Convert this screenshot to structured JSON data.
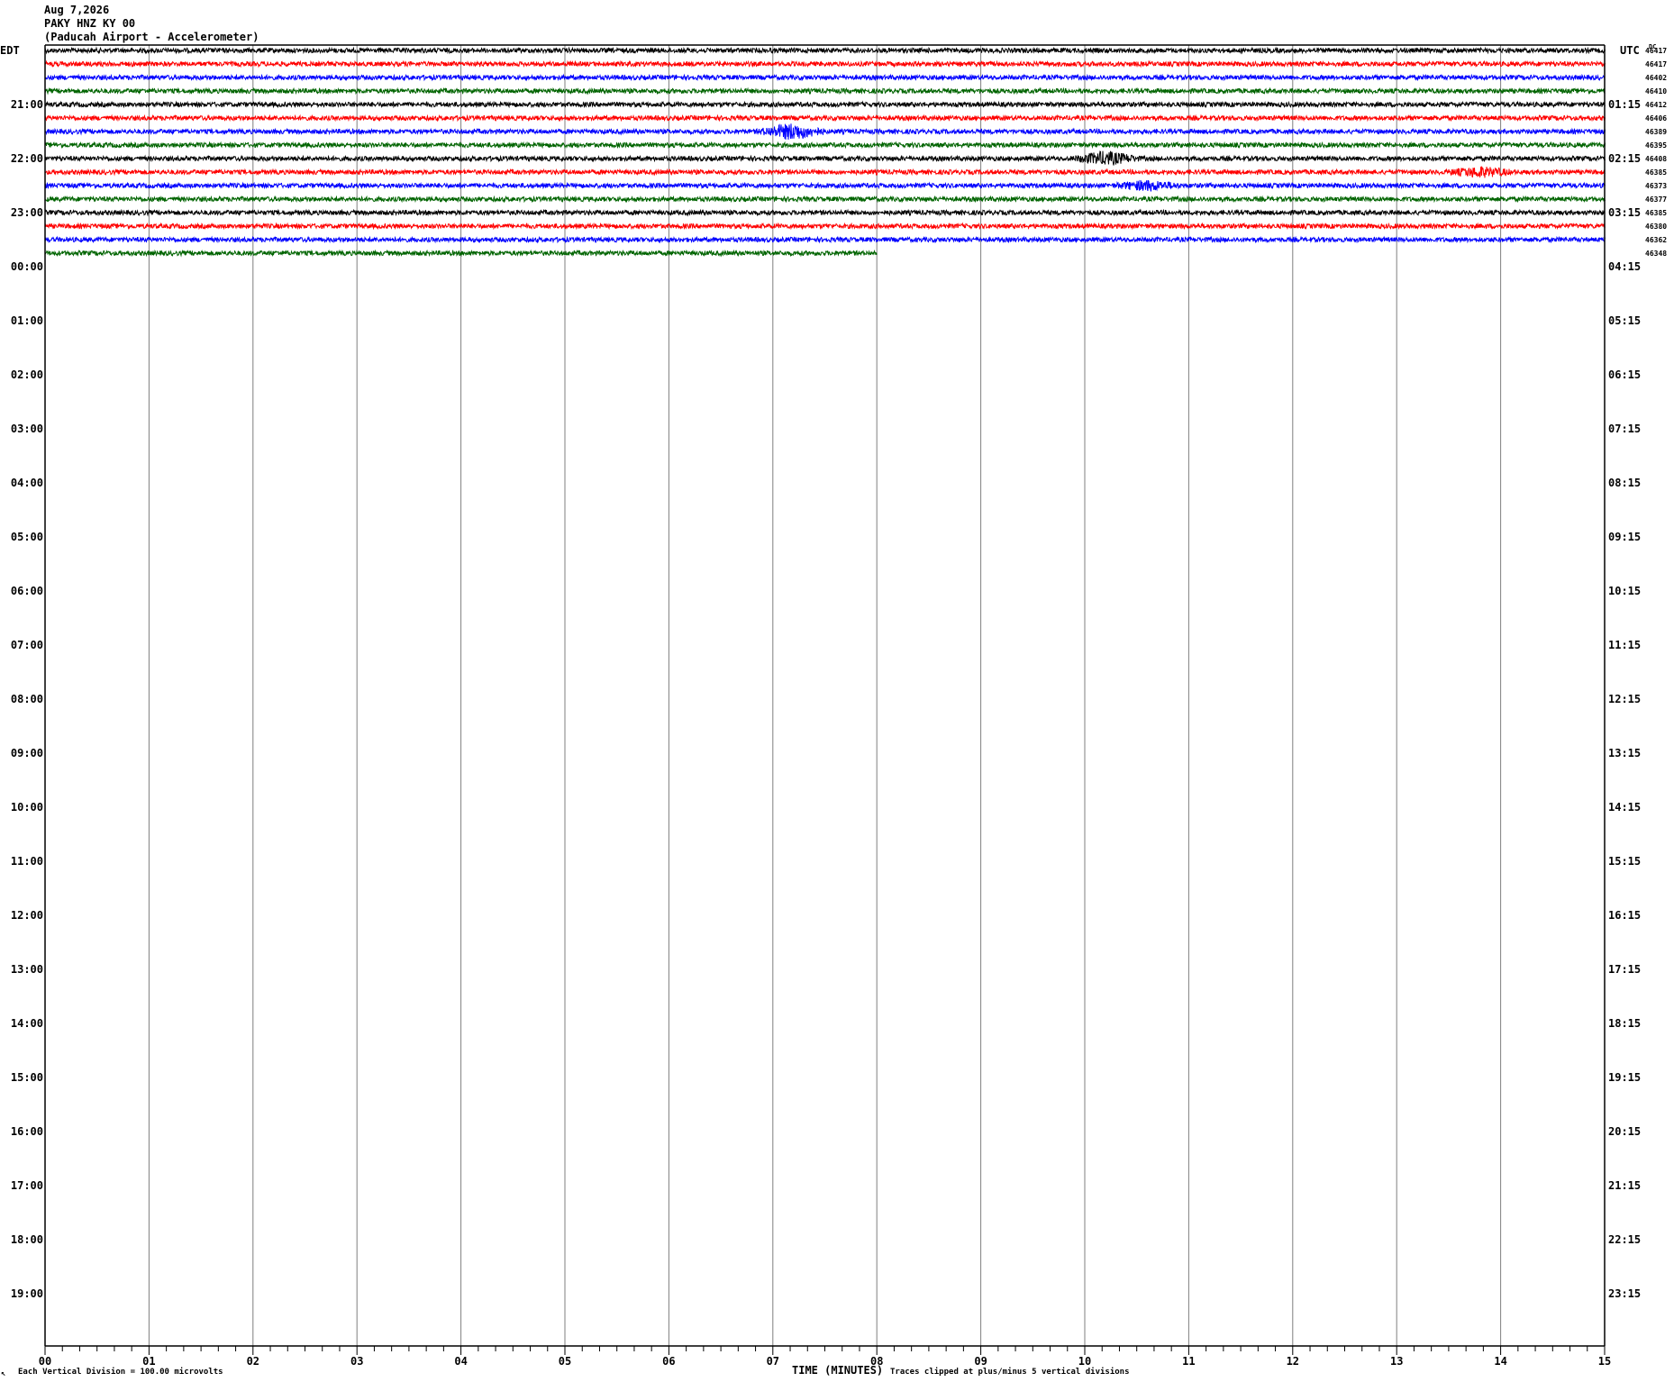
{
  "header": {
    "date": "Aug 7,2026",
    "station": "PAKY HNZ KY 00",
    "location": "(Paducah Airport - Accelerometer)"
  },
  "chart_data": {
    "type": "line",
    "left_timezone": "EDT",
    "right_timezone": "UTC",
    "xlabel": "TIME (MINUTES)",
    "xlim": [
      0,
      15
    ],
    "x_ticks": [
      "00",
      "01",
      "02",
      "03",
      "04",
      "05",
      "06",
      "07",
      "08",
      "09",
      "10",
      "11",
      "12",
      "13",
      "14",
      "15"
    ],
    "left_hour_labels": [
      "21:00",
      "22:00",
      "23:00",
      "00:00",
      "01:00",
      "02:00",
      "03:00",
      "04:00",
      "05:00",
      "06:00",
      "07:00",
      "08:00",
      "09:00",
      "10:00",
      "11:00",
      "12:00",
      "13:00",
      "14:00",
      "15:00",
      "16:00",
      "17:00",
      "18:00",
      "19:00"
    ],
    "right_hour_labels": [
      "01:15",
      "02:15",
      "03:15",
      "04:15",
      "05:15",
      "06:15",
      "07:15",
      "08:15",
      "09:15",
      "10:15",
      "11:15",
      "12:15",
      "13:15",
      "14:15",
      "15:15",
      "16:15",
      "17:15",
      "18:15",
      "19:15",
      "20:15",
      "21:15",
      "22:15",
      "23:15"
    ],
    "trace_colors": [
      "#000000",
      "#ff0000",
      "#0000ff",
      "#006400"
    ],
    "counts_header": "DC",
    "trace_counts": [
      "46417",
      "46417",
      "46402",
      "46410",
      "46412",
      "46406",
      "46389",
      "46395",
      "46408",
      "46385",
      "46373",
      "46377",
      "46385",
      "46380",
      "46362",
      "46348"
    ],
    "last_trace_end_minute": 8,
    "events": [
      {
        "trace": 6,
        "minute": 7.18,
        "amplitude": 2.4
      },
      {
        "trace": 8,
        "minute": 10.2,
        "amplitude": 2.0
      },
      {
        "trace": 9,
        "minute": 13.8,
        "amplitude": 1.4
      },
      {
        "trace": 10,
        "minute": 10.6,
        "amplitude": 1.4
      }
    ],
    "footer_left": "Each Vertical Division =  100.00 microvolts",
    "footer_right": "Traces clipped at plus/minus 5 vertical divisions",
    "corner_mark": "↖"
  }
}
